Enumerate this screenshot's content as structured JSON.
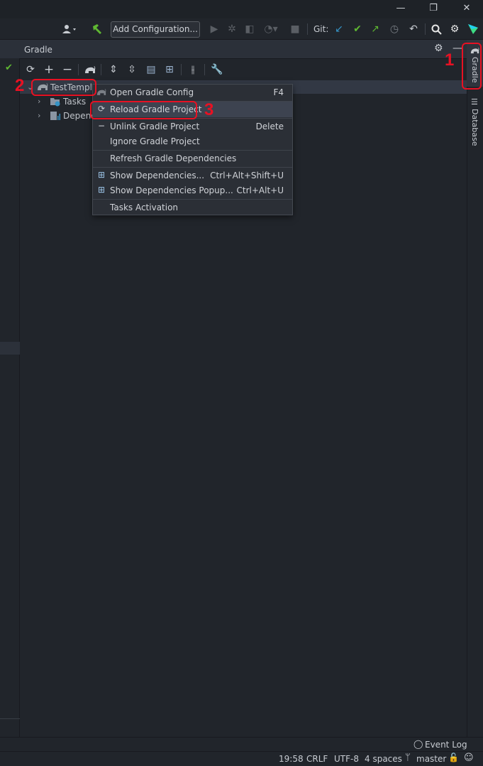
{
  "window": {
    "minimize_glyph": "—",
    "restore_glyph": "❐",
    "close_glyph": "✕"
  },
  "toolbar": {
    "add_configuration": "Add Configuration...",
    "git_label": "Git:",
    "icons": [
      "user-icon",
      "build-hammer-icon",
      "run-icon",
      "debug-icon",
      "coverage-icon",
      "profile-icon",
      "stop-icon",
      "git-update-icon",
      "git-commit-icon",
      "git-push-icon",
      "history-icon",
      "rollback-icon",
      "search-icon",
      "settings-icon",
      "ide-logo-icon"
    ]
  },
  "gradle_panel": {
    "title": "Gradle",
    "toolbar_icons": [
      "reload-icon",
      "add-icon",
      "remove-icon",
      "gradle-elephant-icon",
      "expand-all-icon",
      "collapse-all-icon",
      "group-modules-icon",
      "show-dependencies-icon",
      "toggle-offline-icon",
      "build-tool-settings-icon"
    ],
    "tree": {
      "root": "TestTempla",
      "children": [
        "Tasks",
        "Depend"
      ]
    }
  },
  "right_strip": {
    "gradle_tab": "Gradle",
    "database_tab": "Database"
  },
  "context_menu": {
    "items": [
      {
        "label": "Open Gradle Config",
        "shortcut": "F4"
      },
      {
        "label": "Reload Gradle Project",
        "shortcut": ""
      },
      {
        "label": "Unlink Gradle Project",
        "shortcut": "Delete"
      },
      {
        "label": "Ignore Gradle Project",
        "shortcut": ""
      },
      {
        "label": "Refresh Gradle Dependencies",
        "shortcut": ""
      },
      {
        "label": "Show Dependencies...",
        "shortcut": "Ctrl+Alt+Shift+U"
      },
      {
        "label": "Show Dependencies Popup...",
        "shortcut": "Ctrl+Alt+U"
      },
      {
        "label": "Tasks Activation",
        "shortcut": ""
      }
    ]
  },
  "annotations": [
    "1",
    "2",
    "3"
  ],
  "status_bar": {
    "event_log": "Event Log",
    "time": "19:58",
    "line_sep": "CRLF",
    "encoding": "UTF-8",
    "indent": "4 spaces",
    "branch": "master"
  },
  "colors": {
    "annotation_red": "#e81123",
    "accent_green": "#5fb832",
    "accent_blue": "#3592c4"
  }
}
